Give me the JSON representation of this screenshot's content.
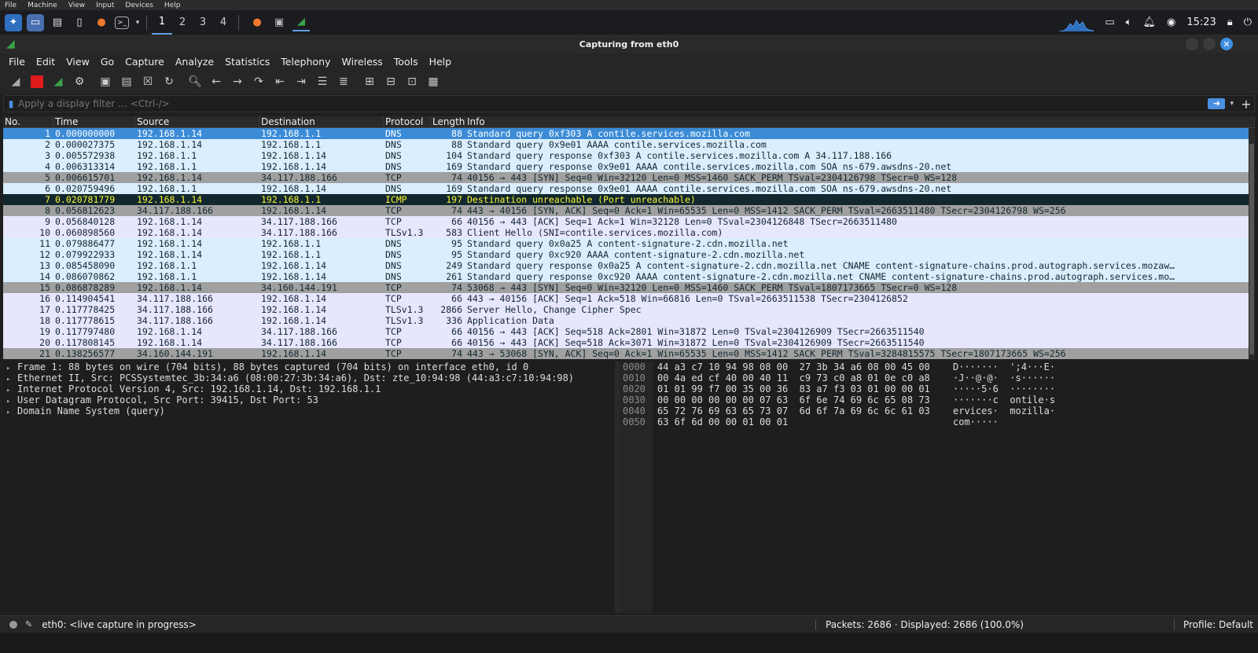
{
  "vbox_menu": [
    "File",
    "Machine",
    "View",
    "Input",
    "Devices",
    "Help"
  ],
  "taskbar": {
    "workspaces": [
      "1",
      "2",
      "3",
      "4"
    ],
    "active_workspace": "1",
    "clock": "15:23",
    "icons": [
      "kali-menu-icon",
      "desktop-icon",
      "files-icon",
      "text-editor-icon",
      "firefox-icon",
      "terminal-icon",
      "wireshark-icon"
    ]
  },
  "window": {
    "title": "Capturing from eth0"
  },
  "menubar": [
    "File",
    "Edit",
    "View",
    "Go",
    "Capture",
    "Analyze",
    "Statistics",
    "Telephony",
    "Wireless",
    "Tools",
    "Help"
  ],
  "filter": {
    "placeholder": "Apply a display filter … <Ctrl-/>"
  },
  "columns": [
    "No.",
    "Time",
    "Source",
    "Destination",
    "Protocol",
    "Length",
    "Info"
  ],
  "packets": [
    {
      "no": "1",
      "time": "0.000000000",
      "src": "192.168.1.14",
      "dst": "192.168.1.1",
      "proto": "DNS",
      "len": "88",
      "info": "Standard query 0xf303 A contile.services.mozilla.com",
      "style": "sel"
    },
    {
      "no": "2",
      "time": "0.000027375",
      "src": "192.168.1.14",
      "dst": "192.168.1.1",
      "proto": "DNS",
      "len": "88",
      "info": "Standard query 0x9e01 AAAA contile.services.mozilla.com",
      "style": "dns"
    },
    {
      "no": "3",
      "time": "0.005572938",
      "src": "192.168.1.1",
      "dst": "192.168.1.14",
      "proto": "DNS",
      "len": "104",
      "info": "Standard query response 0xf303 A contile.services.mozilla.com A 34.117.188.166",
      "style": "dns"
    },
    {
      "no": "4",
      "time": "0.006313314",
      "src": "192.168.1.1",
      "dst": "192.168.1.14",
      "proto": "DNS",
      "len": "169",
      "info": "Standard query response 0x9e01 AAAA contile.services.mozilla.com SOA ns-679.awsdns-20.net",
      "style": "dns"
    },
    {
      "no": "5",
      "time": "0.006615701",
      "src": "192.168.1.14",
      "dst": "34.117.188.166",
      "proto": "TCP",
      "len": "74",
      "info": "40156 → 443 [SYN] Seq=0 Win=32120 Len=0 MSS=1460 SACK_PERM TSval=2304126798 TSecr=0 WS=128",
      "style": "tcpsyn"
    },
    {
      "no": "6",
      "time": "0.020759496",
      "src": "192.168.1.1",
      "dst": "192.168.1.14",
      "proto": "DNS",
      "len": "169",
      "info": "Standard query response 0x9e01 AAAA contile.services.mozilla.com SOA ns-679.awsdns-20.net",
      "style": "dns"
    },
    {
      "no": "7",
      "time": "0.020781779",
      "src": "192.168.1.14",
      "dst": "192.168.1.1",
      "proto": "ICMP",
      "len": "197",
      "info": "Destination unreachable (Port unreachable)",
      "style": "icmp"
    },
    {
      "no": "8",
      "time": "0.056812623",
      "src": "34.117.188.166",
      "dst": "192.168.1.14",
      "proto": "TCP",
      "len": "74",
      "info": "443 → 40156 [SYN, ACK] Seq=0 Ack=1 Win=65535 Len=0 MSS=1412 SACK_PERM TSval=2663511480 TSecr=2304126798 WS=256",
      "style": "tcpsyn"
    },
    {
      "no": "9",
      "time": "0.056840128",
      "src": "192.168.1.14",
      "dst": "34.117.188.166",
      "proto": "TCP",
      "len": "66",
      "info": "40156 → 443 [ACK] Seq=1 Ack=1 Win=32128 Len=0 TSval=2304126848 TSecr=2663511480",
      "style": "tcp"
    },
    {
      "no": "10",
      "time": "0.060898560",
      "src": "192.168.1.14",
      "dst": "34.117.188.166",
      "proto": "TLSv1.3",
      "len": "583",
      "info": "Client Hello (SNI=contile.services.mozilla.com)",
      "style": "tls"
    },
    {
      "no": "11",
      "time": "0.079886477",
      "src": "192.168.1.14",
      "dst": "192.168.1.1",
      "proto": "DNS",
      "len": "95",
      "info": "Standard query 0x0a25 A content-signature-2.cdn.mozilla.net",
      "style": "dns"
    },
    {
      "no": "12",
      "time": "0.079922933",
      "src": "192.168.1.14",
      "dst": "192.168.1.1",
      "proto": "DNS",
      "len": "95",
      "info": "Standard query 0xc920 AAAA content-signature-2.cdn.mozilla.net",
      "style": "dns"
    },
    {
      "no": "13",
      "time": "0.085458090",
      "src": "192.168.1.1",
      "dst": "192.168.1.14",
      "proto": "DNS",
      "len": "249",
      "info": "Standard query response 0x0a25 A content-signature-2.cdn.mozilla.net CNAME content-signature-chains.prod.autograph.services.mozaw…",
      "style": "dns"
    },
    {
      "no": "14",
      "time": "0.086070862",
      "src": "192.168.1.1",
      "dst": "192.168.1.14",
      "proto": "DNS",
      "len": "261",
      "info": "Standard query response 0xc920 AAAA content-signature-2.cdn.mozilla.net CNAME content-signature-chains.prod.autograph.services.mo…",
      "style": "dns"
    },
    {
      "no": "15",
      "time": "0.086878289",
      "src": "192.168.1.14",
      "dst": "34.160.144.191",
      "proto": "TCP",
      "len": "74",
      "info": "53068 → 443 [SYN] Seq=0 Win=32120 Len=0 MSS=1460 SACK_PERM TSval=1807173665 TSecr=0 WS=128",
      "style": "tcpsyn"
    },
    {
      "no": "16",
      "time": "0.114904541",
      "src": "34.117.188.166",
      "dst": "192.168.1.14",
      "proto": "TCP",
      "len": "66",
      "info": "443 → 40156 [ACK] Seq=1 Ack=518 Win=66816 Len=0 TSval=2663511538 TSecr=2304126852",
      "style": "tcp"
    },
    {
      "no": "17",
      "time": "0.117778425",
      "src": "34.117.188.166",
      "dst": "192.168.1.14",
      "proto": "TLSv1.3",
      "len": "2866",
      "info": "Server Hello, Change Cipher Spec",
      "style": "tls"
    },
    {
      "no": "18",
      "time": "0.117778615",
      "src": "34.117.188.166",
      "dst": "192.168.1.14",
      "proto": "TLSv1.3",
      "len": "336",
      "info": "Application Data",
      "style": "tls"
    },
    {
      "no": "19",
      "time": "0.117797480",
      "src": "192.168.1.14",
      "dst": "34.117.188.166",
      "proto": "TCP",
      "len": "66",
      "info": "40156 → 443 [ACK] Seq=518 Ack=2801 Win=31872 Len=0 TSval=2304126909 TSecr=2663511540",
      "style": "tcp"
    },
    {
      "no": "20",
      "time": "0.117808145",
      "src": "192.168.1.14",
      "dst": "34.117.188.166",
      "proto": "TCP",
      "len": "66",
      "info": "40156 → 443 [ACK] Seq=518 Ack=3071 Win=31872 Len=0 TSval=2304126909 TSecr=2663511540",
      "style": "tcp"
    },
    {
      "no": "21",
      "time": "0.138256577",
      "src": "34.160.144.191",
      "dst": "192.168.1.14",
      "proto": "TCP",
      "len": "74",
      "info": "443 → 53068 [SYN, ACK] Seq=0 Ack=1 Win=65535 Len=0 MSS=1412 SACK_PERM TSval=3284815575 TSecr=1807173665 WS=256",
      "style": "tcpsyn"
    }
  ],
  "details": [
    "Frame 1: 88 bytes on wire (704 bits), 88 bytes captured (704 bits) on interface eth0, id 0",
    "Ethernet II, Src: PCSSystemtec_3b:34:a6 (08:00:27:3b:34:a6), Dst: zte_10:94:98 (44:a3:c7:10:94:98)",
    "Internet Protocol Version 4, Src: 192.168.1.14, Dst: 192.168.1.1",
    "User Datagram Protocol, Src Port: 39415, Dst Port: 53",
    "Domain Name System (query)"
  ],
  "bytes": {
    "offsets": [
      "0000",
      "0010",
      "0020",
      "0030",
      "0040",
      "0050"
    ],
    "hex": [
      "44 a3 c7 10 94 98 08 00  27 3b 34 a6 08 00 45 00",
      "00 4a ed cf 40 00 40 11  c9 73 c0 a8 01 0e c0 a8",
      "01 01 99 f7 00 35 00 36  83 a7 f3 03 01 00 00 01",
      "00 00 00 00 00 00 07 63  6f 6e 74 69 6c 65 08 73",
      "65 72 76 69 63 65 73 07  6d 6f 7a 69 6c 6c 61 03",
      "63 6f 6d 00 00 01 00 01"
    ],
    "ascii": [
      "D·······  ';4···E·",
      "·J··@·@·  ·s······",
      "·····5·6  ········",
      "·······c  ontile·s",
      "ervices·  mozilla·",
      "com·····"
    ]
  },
  "status": {
    "live": "eth0: <live capture in progress>",
    "packets": "Packets: 2686 · Displayed: 2686 (100.0%)",
    "profile": "Profile: Default"
  }
}
